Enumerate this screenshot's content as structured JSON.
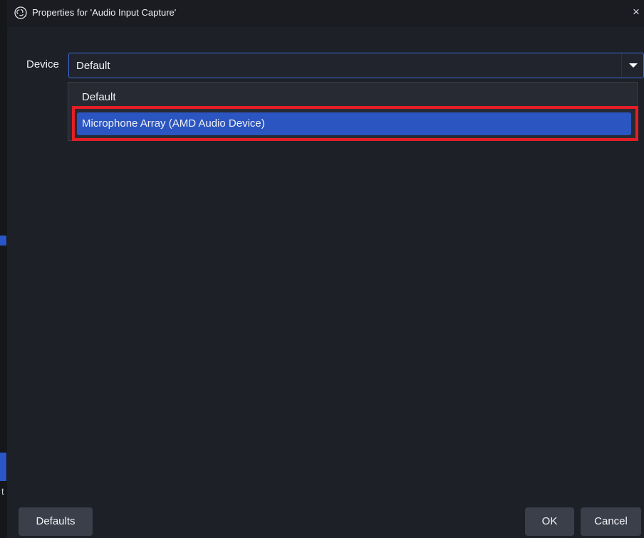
{
  "window": {
    "title": "Properties for 'Audio Input Capture'",
    "icon": "obs-logo-icon",
    "close_icon": "close-icon",
    "close_glyph": "×"
  },
  "device": {
    "label": "Device",
    "selected_value": "Default",
    "dropdown_icon": "chevron-down-icon",
    "options": [
      {
        "label": "Default"
      },
      {
        "label": "Microphone Array (AMD Audio Device)"
      }
    ]
  },
  "buttons": {
    "defaults": "Defaults",
    "ok": "OK",
    "cancel": "Cancel"
  },
  "background_fragments": {
    "frag_1": "t"
  },
  "colors": {
    "accent_blue": "#2b55c0",
    "focus_border": "#3d6ad6",
    "annotation_red": "#e41e26",
    "dialog_bg": "#1d2027"
  }
}
